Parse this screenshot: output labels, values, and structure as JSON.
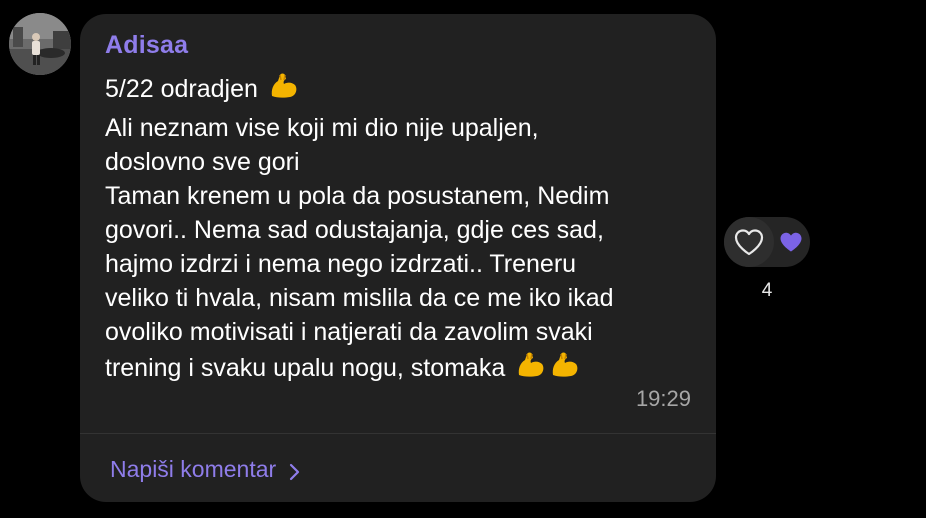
{
  "post": {
    "author": "Adisaa",
    "lines": [
      "5/22 odradjen",
      "Ali neznam vise koji mi dio nije upaljen,",
      "doslovno sve gori",
      "Taman krenem u pola da posustanem, Nedim",
      "govori.. Nema sad odustajanja, gdje ces sad,",
      "hajmo izdrzi i nema nego izdrzati.. Treneru",
      "veliko ti hvala, nisam mislila da ce me iko ikad",
      "ovoliko motivisati i natjerati da zavolim svaki",
      "trening i svaku upalu nogu, stomaka"
    ],
    "emoji": "flexed-biceps",
    "time": "19:29"
  },
  "comment": {
    "label": "Napiši komentar"
  },
  "reactions": {
    "count": "4",
    "heart_color": "#7b63e6"
  },
  "colors": {
    "accent": "#8f7dea",
    "bubble": "#212121",
    "background": "#000000"
  }
}
